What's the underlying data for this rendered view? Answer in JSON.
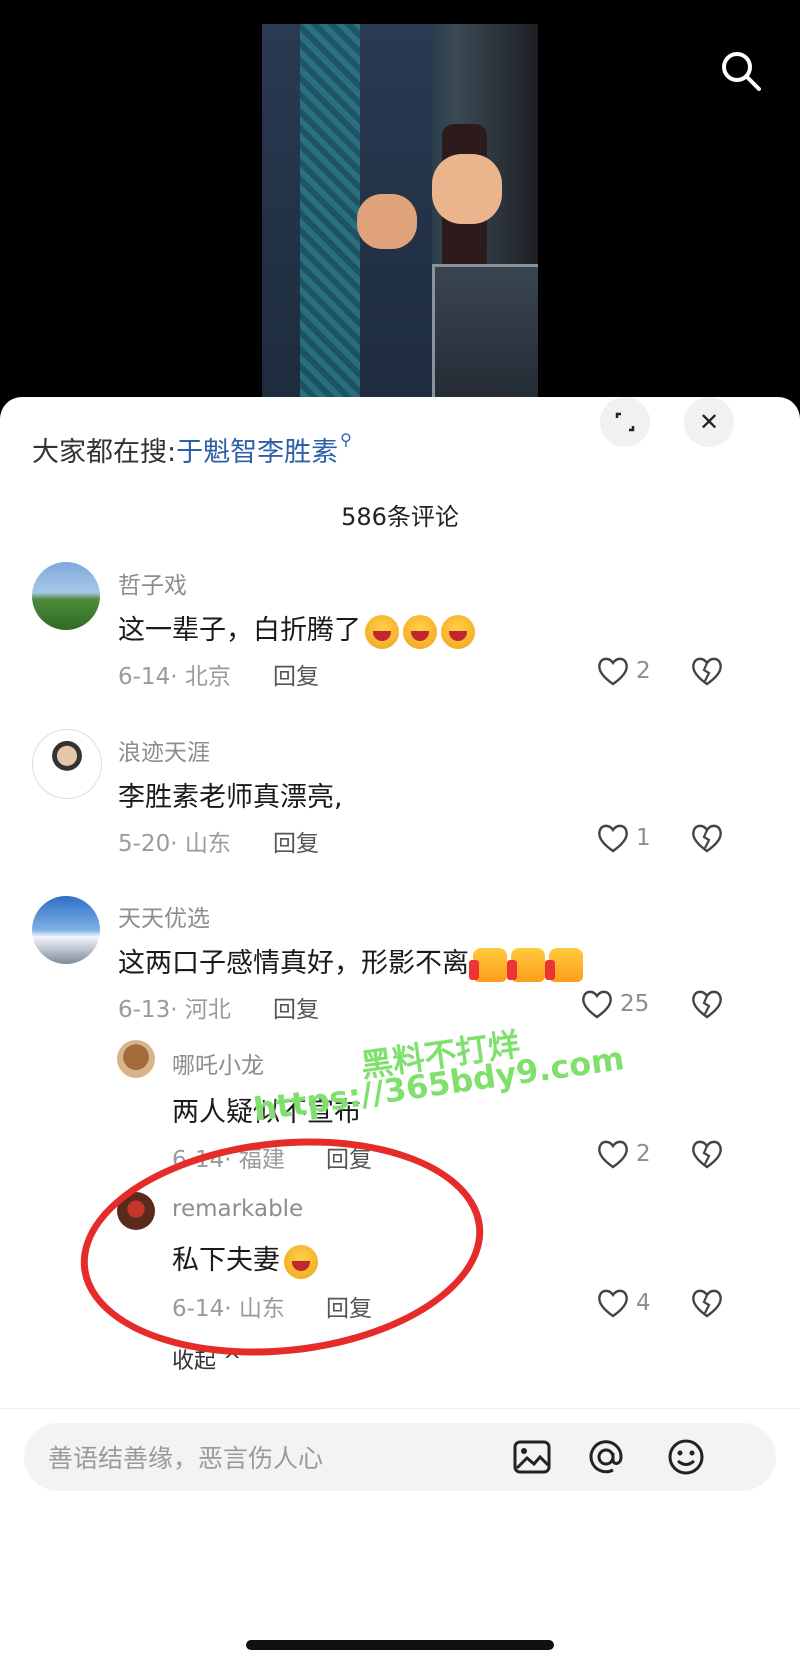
{
  "hot_search": {
    "prefix": "大家都在搜:",
    "keyword": "于魁智李胜素"
  },
  "comment_count": "586条评论",
  "comments": [
    {
      "user": "哲子戏",
      "text": "这一辈子，白折腾了",
      "emojis": [
        "laugh",
        "laugh",
        "laugh"
      ],
      "date_loc": "6-14· 北京",
      "reply": "回复",
      "likes": "2"
    },
    {
      "user": "浪迹天涯",
      "text": "李胜素老师真漂亮,",
      "emojis": [],
      "date_loc": "5-20· 山东",
      "reply": "回复",
      "likes": "1"
    },
    {
      "user": "天天优选",
      "text": "这两口子感情真好，形影不离",
      "emojis": [
        "thumb",
        "thumb",
        "thumb"
      ],
      "date_loc": "6-13· 河北",
      "reply": "回复",
      "likes": "25"
    }
  ],
  "replies": [
    {
      "user": "哪吒小龙",
      "text": "两人疑似不宣布",
      "date_loc": "6-14· 福建",
      "reply": "回复",
      "likes": "2"
    },
    {
      "user": "remarkable",
      "text": "私下夫妻",
      "date_loc": "6-14· 山东",
      "reply": "回复",
      "likes": "4"
    }
  ],
  "collapse_label": "收起 ^",
  "input_placeholder": "善语结善缘，恶言伤人心",
  "watermark": {
    "line1": "黑料不打烊",
    "line2": "https://365bdy9.com"
  },
  "colors": {
    "accent_link": "#2f5fa8",
    "annotation_red": "#e62b2b",
    "watermark_green": "#7fe06e"
  }
}
